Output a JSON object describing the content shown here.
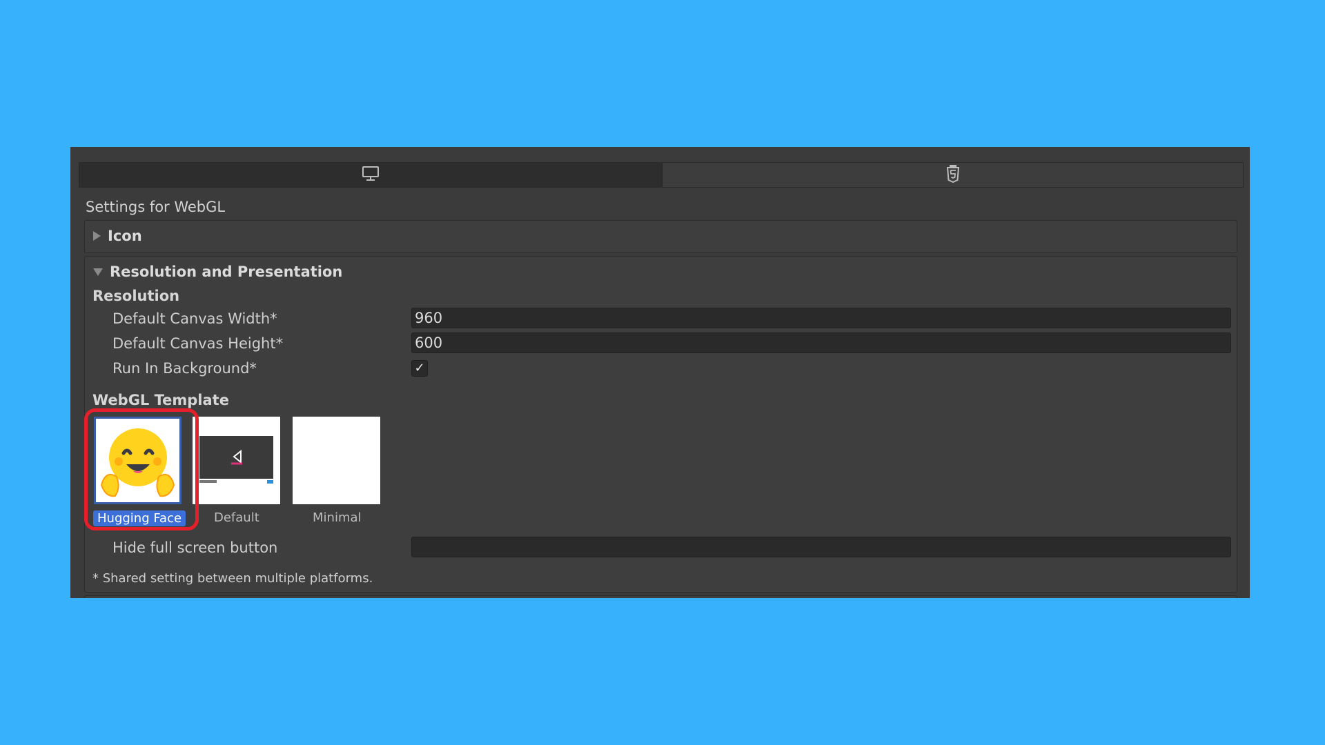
{
  "tabs": [
    {
      "name": "Standalone",
      "icon": "monitor-icon"
    },
    {
      "name": "WebGL",
      "icon": "html5-icon"
    }
  ],
  "settings_title": "Settings for WebGL",
  "sections": {
    "icon": {
      "title": "Icon",
      "expanded": false
    },
    "resolution_presentation": {
      "title": "Resolution and Presentation",
      "expanded": true
    }
  },
  "resolution": {
    "header": "Resolution",
    "canvas_width": {
      "label": "Default Canvas Width*",
      "value": "960"
    },
    "canvas_height": {
      "label": "Default Canvas Height*",
      "value": "600"
    },
    "run_in_background": {
      "label": "Run In Background*",
      "checked": true,
      "mark": "✓"
    }
  },
  "webgl_template": {
    "header": "WebGL Template",
    "options": [
      {
        "label": "Hugging Face",
        "selected": true,
        "icon": "hugging-face-emoji-icon"
      },
      {
        "label": "Default",
        "selected": false,
        "icon": "unity-default-preview-icon"
      },
      {
        "label": "Minimal",
        "selected": false,
        "icon": "blank-preview-icon"
      }
    ]
  },
  "hide_fullscreen": {
    "label": "Hide full screen button",
    "value": ""
  },
  "footnote": "* Shared setting between multiple platforms.",
  "colors": {
    "background": "#38b1fd",
    "panel": "#3b3b3b",
    "field": "#2a2a2a",
    "selection": "#3c6fd8",
    "highlight": "#e6202a"
  }
}
